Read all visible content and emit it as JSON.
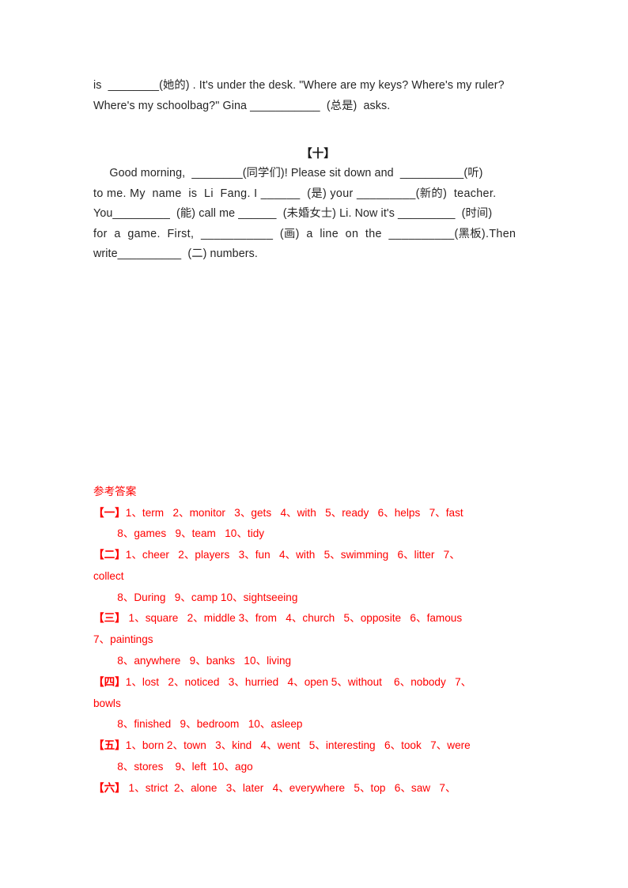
{
  "document": {
    "exercise_nine_tail": {
      "lines": [
        "is  ________(她的) . It's under the desk. \"Where are my keys? Where's my ruler?",
        "Where's my schoolbag?\" Gina ___________  (总是)  asks."
      ]
    },
    "section_ten": {
      "heading": "【十】",
      "lines": [
        "     Good morning,  ________(同学们)! Please sit down and  __________(听)",
        "to me. My  name  is  Li  Fang. I ______  (是) your _________(新的)  teacher.",
        "You_________  (能) call me ______  (未婚女士) Li. Now it's _________  (时间)",
        "for  a  game.  First,  ___________  (画)  a  line  on  the  __________(黑板).Then",
        "write__________  (二) numbers."
      ]
    },
    "answer_key": {
      "title": "参考答案",
      "entries": [
        {
          "marker": "【一】",
          "line1": "1、term   2、monitor   3、gets   4、with   5、ready   6、helps   7、fast",
          "wrap": null,
          "line2": "        8、games   9、team   10、tidy"
        },
        {
          "marker": "【二】",
          "line1": "1、cheer   2、players   3、fun   4、with   5、swimming   6、litter   7、",
          "wrap": "collect",
          "line2": "        8、During   9、camp 10、sightseeing"
        },
        {
          "marker": "【三】",
          "line1": " 1、square   2、middle 3、from   4、church   5、opposite   6、famous",
          "wrap": "7、paintings",
          "line2": "        8、anywhere   9、banks   10、living"
        },
        {
          "marker": "【四】",
          "line1": "1、lost   2、noticed   3、hurried   4、open 5、without    6、nobody   7、",
          "wrap": "bowls",
          "line2": "        8、finished   9、bedroom   10、asleep"
        },
        {
          "marker": "【五】",
          "line1": "1、born 2、town   3、kind   4、went   5、interesting   6、took   7、were",
          "wrap": null,
          "line2": "        8、stores    9、left  10、ago"
        },
        {
          "marker": "【六】",
          "line1": " 1、strict  2、alone   3、later   4、everywhere   5、top   6、saw   7、",
          "wrap": null,
          "line2": null
        }
      ]
    },
    "colors": {
      "answer_red": "#ff0000",
      "body_text": "#262626",
      "page_background": "#ffffff"
    }
  }
}
